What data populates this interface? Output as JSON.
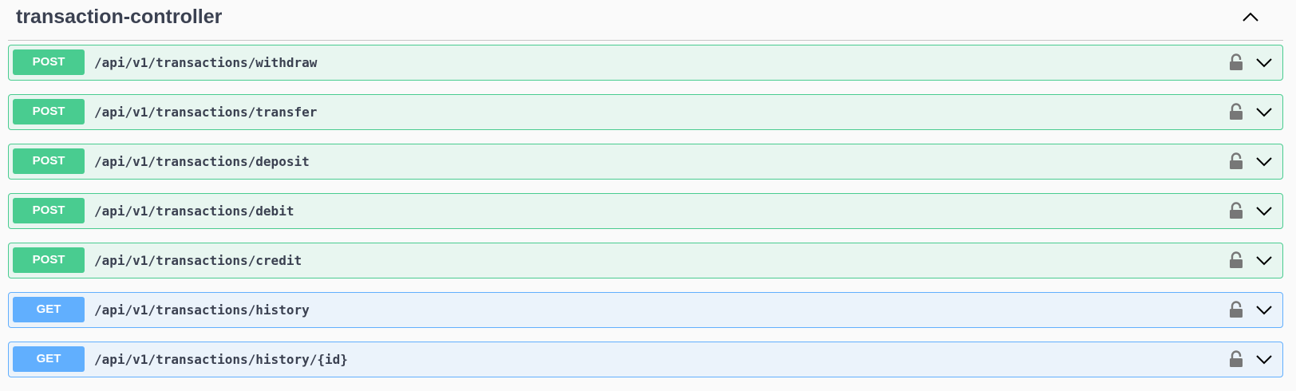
{
  "section": {
    "title": "transaction-controller",
    "collapse_icon": "chevron-up-icon"
  },
  "colors": {
    "post": "#49cc90",
    "post_bg": "#e8f6f0",
    "get": "#61affe",
    "get_bg": "#ebf3fb",
    "text": "#3b4151",
    "icon": "#777777"
  },
  "operations": [
    {
      "method": "POST",
      "path": "/api/v1/transactions/withdraw",
      "lock_icon": "lock-icon",
      "expand_icon": "chevron-down-icon"
    },
    {
      "method": "POST",
      "path": "/api/v1/transactions/transfer",
      "lock_icon": "lock-icon",
      "expand_icon": "chevron-down-icon"
    },
    {
      "method": "POST",
      "path": "/api/v1/transactions/deposit",
      "lock_icon": "lock-icon",
      "expand_icon": "chevron-down-icon"
    },
    {
      "method": "POST",
      "path": "/api/v1/transactions/debit",
      "lock_icon": "lock-icon",
      "expand_icon": "chevron-down-icon"
    },
    {
      "method": "POST",
      "path": "/api/v1/transactions/credit",
      "lock_icon": "lock-icon",
      "expand_icon": "chevron-down-icon"
    },
    {
      "method": "GET",
      "path": "/api/v1/transactions/history",
      "lock_icon": "lock-icon",
      "expand_icon": "chevron-down-icon"
    },
    {
      "method": "GET",
      "path": "/api/v1/transactions/history/{id}",
      "lock_icon": "lock-icon",
      "expand_icon": "chevron-down-icon"
    }
  ]
}
